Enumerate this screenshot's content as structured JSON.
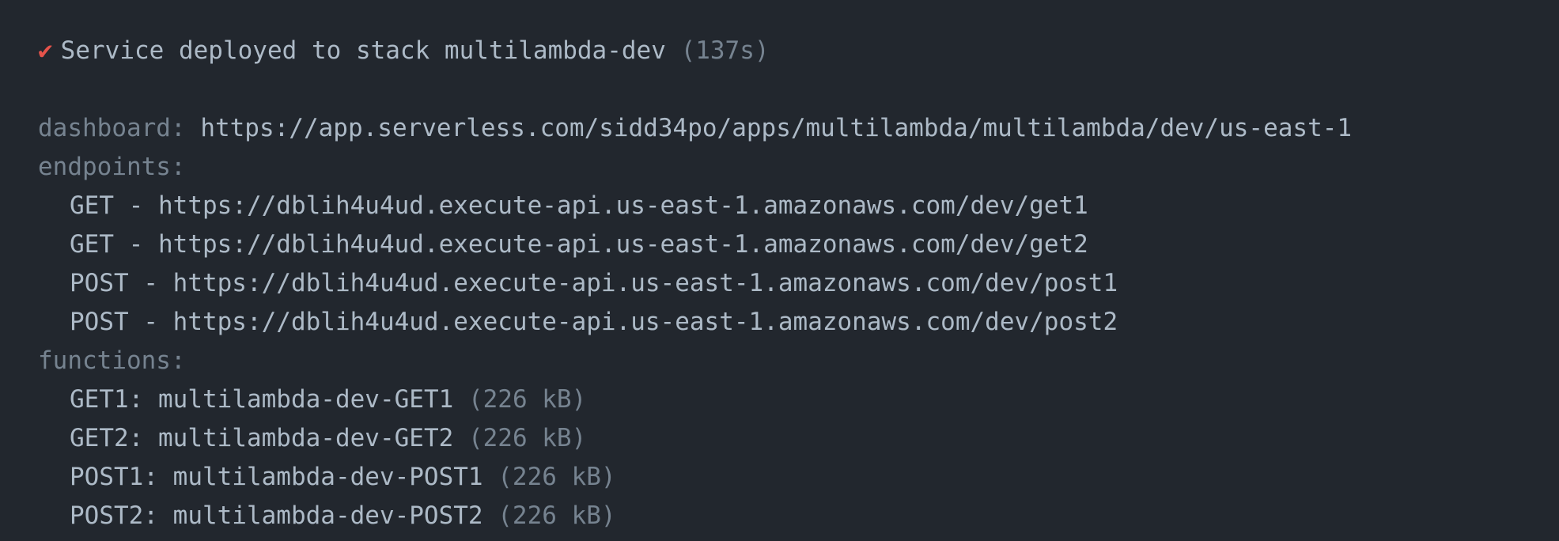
{
  "deploy": {
    "check_icon": "✔",
    "message": "Service deployed to stack multilambda-dev",
    "duration": "(137s)"
  },
  "dashboard": {
    "label": "dashboard:",
    "url": "https://app.serverless.com/sidd34po/apps/multilambda/multilambda/dev/us-east-1"
  },
  "endpoints": {
    "label": "endpoints:",
    "items": [
      {
        "method": "GET",
        "url": "https://dblih4u4ud.execute-api.us-east-1.amazonaws.com/dev/get1"
      },
      {
        "method": "GET",
        "url": "https://dblih4u4ud.execute-api.us-east-1.amazonaws.com/dev/get2"
      },
      {
        "method": "POST",
        "url": "https://dblih4u4ud.execute-api.us-east-1.amazonaws.com/dev/post1"
      },
      {
        "method": "POST",
        "url": "https://dblih4u4ud.execute-api.us-east-1.amazonaws.com/dev/post2"
      }
    ]
  },
  "functions": {
    "label": "functions:",
    "items": [
      {
        "key": "GET1:",
        "name": "multilambda-dev-GET1",
        "size": "(226 kB)"
      },
      {
        "key": "GET2:",
        "name": "multilambda-dev-GET2",
        "size": "(226 kB)"
      },
      {
        "key": "POST1:",
        "name": "multilambda-dev-POST1",
        "size": "(226 kB)"
      },
      {
        "key": "POST2:",
        "name": "multilambda-dev-POST2",
        "size": "(226 kB)"
      }
    ]
  },
  "colors": {
    "background": "#22272e",
    "text": "#adbac7",
    "muted": "#768390",
    "success": "#e5534b"
  }
}
